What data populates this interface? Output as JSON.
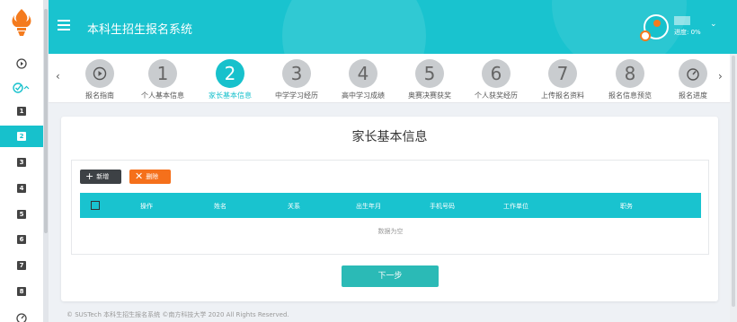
{
  "header": {
    "title": "本科生招生报名系统",
    "progress_text": "进度: 0%"
  },
  "sidebar": {
    "items": [
      {
        "icon": "play-circle-icon",
        "label": ""
      },
      {
        "icon": "check-circle-icon",
        "label": ""
      },
      {
        "icon": "square-1",
        "label": "1"
      },
      {
        "icon": "square-2",
        "label": "2",
        "active": true
      },
      {
        "icon": "square-3",
        "label": "3"
      },
      {
        "icon": "square-4",
        "label": "4"
      },
      {
        "icon": "square-5",
        "label": "5"
      },
      {
        "icon": "square-6",
        "label": "6"
      },
      {
        "icon": "square-7",
        "label": "7"
      },
      {
        "icon": "square-8",
        "label": "8"
      }
    ]
  },
  "steps": [
    {
      "number": "",
      "icon": "play-circle-icon",
      "label": "报名指南"
    },
    {
      "number": "1",
      "label": "个人基本信息"
    },
    {
      "number": "2",
      "label": "家长基本信息",
      "active": true
    },
    {
      "number": "3",
      "label": "中学学习经历"
    },
    {
      "number": "4",
      "label": "高中学习成绩"
    },
    {
      "number": "5",
      "label": "奥赛决赛获奖"
    },
    {
      "number": "6",
      "label": "个人获奖经历"
    },
    {
      "number": "7",
      "label": "上传报名资料"
    },
    {
      "number": "8",
      "label": "报名信息预览"
    },
    {
      "number": "",
      "icon": "gauge-icon",
      "label": "报名进度"
    }
  ],
  "main": {
    "title": "家长基本信息",
    "add_label": "新增",
    "delete_label": "删除",
    "columns": [
      "操作",
      "姓名",
      "关系",
      "出生年月",
      "手机号码",
      "工作单位",
      "职务"
    ],
    "empty_text": "数据为空",
    "next_label": "下一步"
  },
  "footer": {
    "text": "© SUSTech 本科生招生报名系统 ©南方科技大学 2020 All Rights Reserved."
  },
  "colors": {
    "primary": "#19c3cf",
    "accent_orange": "#f5701b",
    "dark_button": "#3d4145",
    "next_button": "#2bbab6"
  }
}
